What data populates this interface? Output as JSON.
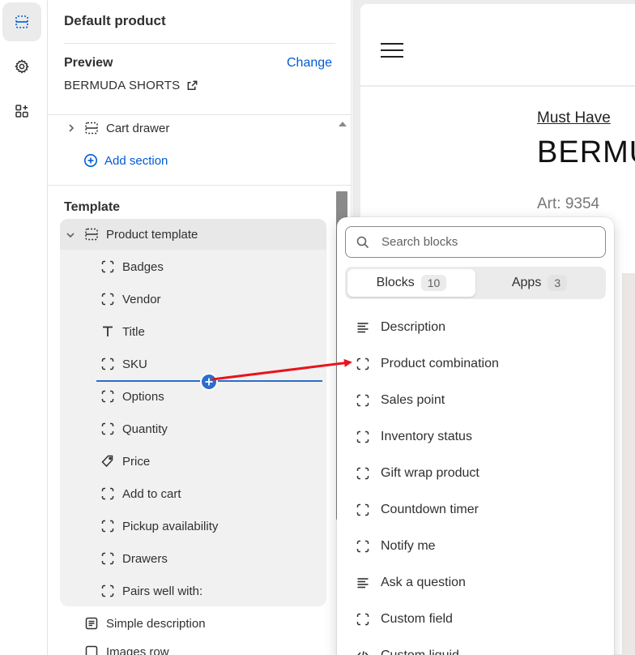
{
  "rail": {
    "items": [
      {
        "name": "sections",
        "icon": "sections-icon",
        "active": true
      },
      {
        "name": "settings",
        "icon": "gear-icon",
        "active": false
      },
      {
        "name": "apps",
        "icon": "apps-add-icon",
        "active": false
      }
    ]
  },
  "sidebar": {
    "title": "Default product",
    "preview_label": "Preview",
    "change_label": "Change",
    "preview_value": "BERMUDA SHORTS",
    "cart_drawer": "Cart drawer",
    "add_section": "Add section",
    "template_label": "Template",
    "product_template": "Product template",
    "blocks": [
      {
        "label": "Badges",
        "icon": "block-icon"
      },
      {
        "label": "Vendor",
        "icon": "block-icon"
      },
      {
        "label": "Title",
        "icon": "text-icon"
      },
      {
        "label": "SKU",
        "icon": "block-icon"
      },
      {
        "label": "Options",
        "icon": "block-icon"
      },
      {
        "label": "Quantity",
        "icon": "block-icon"
      },
      {
        "label": "Price",
        "icon": "price-tag-icon"
      },
      {
        "label": "Add to cart",
        "icon": "block-icon"
      },
      {
        "label": "Pickup availability",
        "icon": "block-icon"
      },
      {
        "label": "Drawers",
        "icon": "block-icon"
      },
      {
        "label": "Pairs well with:",
        "icon": "block-icon"
      }
    ],
    "simple_description": "Simple description",
    "images_row_partial": "Images row"
  },
  "storefront": {
    "must_have": "Must Have",
    "product_title_partial": "BERMU",
    "art": "Art: 9354"
  },
  "picker": {
    "search_placeholder": "Search blocks",
    "tabs": [
      {
        "label": "Blocks",
        "count": "10",
        "active": true
      },
      {
        "label": "Apps",
        "count": "3",
        "active": false
      }
    ],
    "items": [
      {
        "label": "Description",
        "icon": "text-lines-icon"
      },
      {
        "label": "Product combination",
        "icon": "block-icon"
      },
      {
        "label": "Sales point",
        "icon": "block-icon"
      },
      {
        "label": "Inventory status",
        "icon": "block-icon"
      },
      {
        "label": "Gift wrap product",
        "icon": "block-icon"
      },
      {
        "label": "Countdown timer",
        "icon": "block-icon"
      },
      {
        "label": "Notify me",
        "icon": "block-icon"
      },
      {
        "label": "Ask a question",
        "icon": "text-lines-icon"
      },
      {
        "label": "Custom field",
        "icon": "block-icon"
      },
      {
        "label": "Custom liquid",
        "icon": "code-icon"
      }
    ]
  },
  "colors": {
    "link_blue": "#005bd3",
    "insert_blue": "#2c6ecb",
    "annotation_red": "#e8141b"
  }
}
